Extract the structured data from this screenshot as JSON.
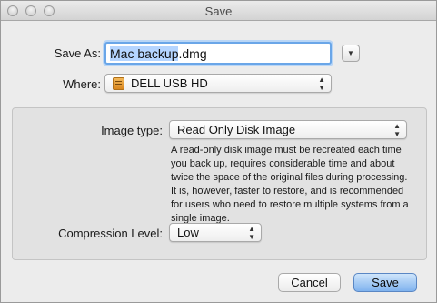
{
  "window": {
    "title": "Save"
  },
  "save_as": {
    "label": "Save As:",
    "value": "Mac backup.dmg",
    "selected_part": "Mac backup",
    "extension": ".dmg"
  },
  "where": {
    "label": "Where:",
    "selected": "DELL USB HD"
  },
  "image_type": {
    "label": "Image type:",
    "selected": "Read Only Disk Image",
    "description": "A read-only disk image must be recreated each time you back up, requires considerable time and about twice the space of the original files during processing. It is, however, faster to restore, and is recommended for users who need to restore multiple systems from a single image."
  },
  "compression": {
    "label": "Compression Level:",
    "selected": "Low"
  },
  "buttons": {
    "cancel": "Cancel",
    "save": "Save"
  },
  "icons": {
    "expand": "disclosure-down-icon",
    "popup_arrows": "up-down-arrows-icon",
    "drive": "external-drive-icon"
  }
}
